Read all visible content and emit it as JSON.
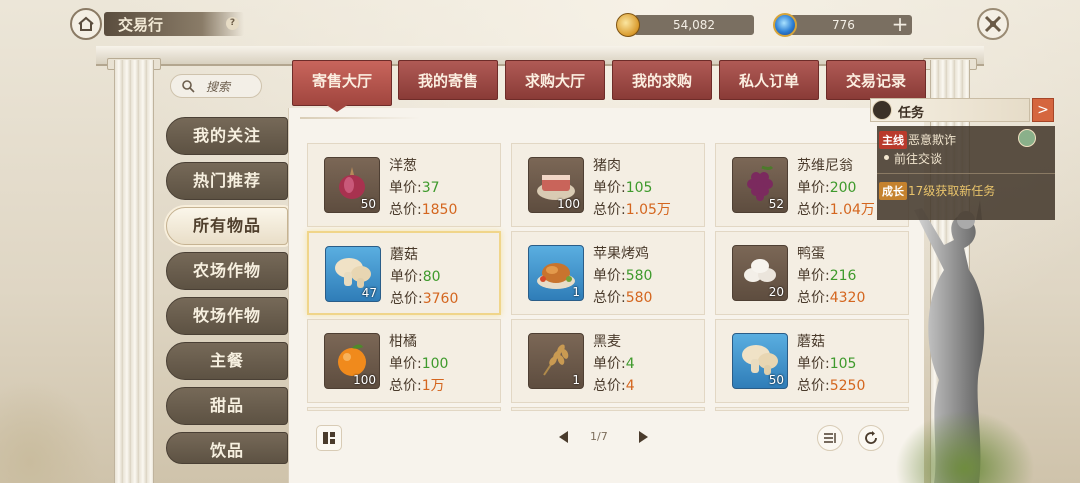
{
  "header": {
    "title": "交易行",
    "help_label": "?",
    "gold_amount": "54,082",
    "gem_amount": "776",
    "plus_label": "+"
  },
  "search": {
    "label": "搜索"
  },
  "sidebar": {
    "items": [
      {
        "label": "我的关注",
        "active": false
      },
      {
        "label": "热门推荐",
        "active": false
      },
      {
        "label": "所有物品",
        "active": true
      },
      {
        "label": "农场作物",
        "active": false
      },
      {
        "label": "牧场作物",
        "active": false
      },
      {
        "label": "主餐",
        "active": false
      },
      {
        "label": "甜品",
        "active": false
      },
      {
        "label": "饮品",
        "active": false
      }
    ]
  },
  "tabs": [
    {
      "label": "寄售大厅",
      "active": true
    },
    {
      "label": "我的寄售",
      "active": false
    },
    {
      "label": "求购大厅",
      "active": false
    },
    {
      "label": "我的求购",
      "active": false
    },
    {
      "label": "私人订单",
      "active": false
    },
    {
      "label": "交易记录",
      "active": false
    }
  ],
  "labels": {
    "unit_price": "单价:",
    "total_price": "总价:"
  },
  "items": [
    {
      "name": "洋葱",
      "qty": "50",
      "unit": "37",
      "total": "1850",
      "icon": "onion-icon"
    },
    {
      "name": "猪肉",
      "qty": "100",
      "unit": "105",
      "total": "1.05万",
      "icon": "pork-icon"
    },
    {
      "name": "苏维尼翁",
      "qty": "52",
      "unit": "200",
      "total": "1.04万",
      "icon": "grape-icon"
    },
    {
      "name": "蘑菇",
      "qty": "47",
      "unit": "80",
      "total": "3760",
      "icon": "mushroom-icon",
      "selected": true
    },
    {
      "name": "苹果烤鸡",
      "qty": "1",
      "unit": "580",
      "total": "580",
      "icon": "roast-chicken-icon"
    },
    {
      "name": "鸭蛋",
      "qty": "20",
      "unit": "216",
      "total": "4320",
      "icon": "duck-egg-icon"
    },
    {
      "name": "柑橘",
      "qty": "100",
      "unit": "100",
      "total": "1万",
      "icon": "orange-icon"
    },
    {
      "name": "黑麦",
      "qty": "1",
      "unit": "4",
      "total": "4",
      "icon": "rye-icon"
    },
    {
      "name": "蘑菇",
      "qty": "50",
      "unit": "105",
      "total": "5250",
      "icon": "mushroom-icon"
    }
  ],
  "pagination": {
    "text": "1/7"
  },
  "task_panel": {
    "title": "任务",
    "main_tag": "主线",
    "main_title": "恶意欺诈",
    "main_sub": "前往交谈",
    "growth_tag": "成长",
    "growth_text": "17级获取新任务"
  },
  "colors": {
    "accent_tab": "#a1463f",
    "unit_price": "#3e9a2c",
    "total_price": "#d4661f"
  }
}
